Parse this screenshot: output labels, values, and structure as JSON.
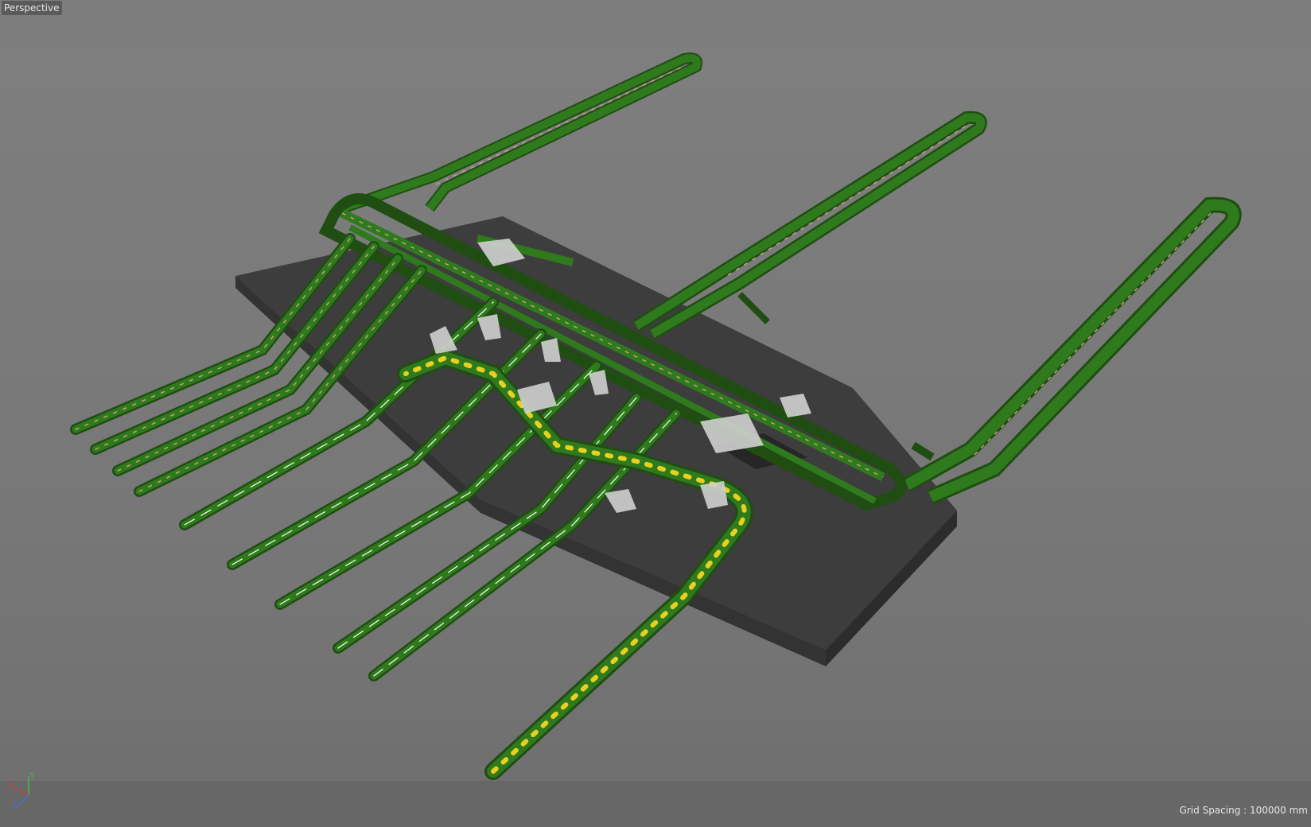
{
  "viewport": {
    "view_name": "Perspective",
    "grid_spacing": "Grid Spacing : 100000 mm"
  },
  "axis_gizmo": {
    "x_label": "X",
    "y_label": "Y",
    "z_label": "Z",
    "x_color": "#d04040",
    "y_color": "#40c040",
    "z_color": "#4070e0"
  },
  "scene": {
    "description_colors": {
      "conveyor": "#2f6e1a",
      "conveyor_edge": "#1e4a10",
      "platform_top": "#3c3c3c",
      "platform_side": "#2e2e2e",
      "yellow_items": "#e8d020",
      "brown_items": "#b08060",
      "chute": "#d8d8d8"
    }
  }
}
